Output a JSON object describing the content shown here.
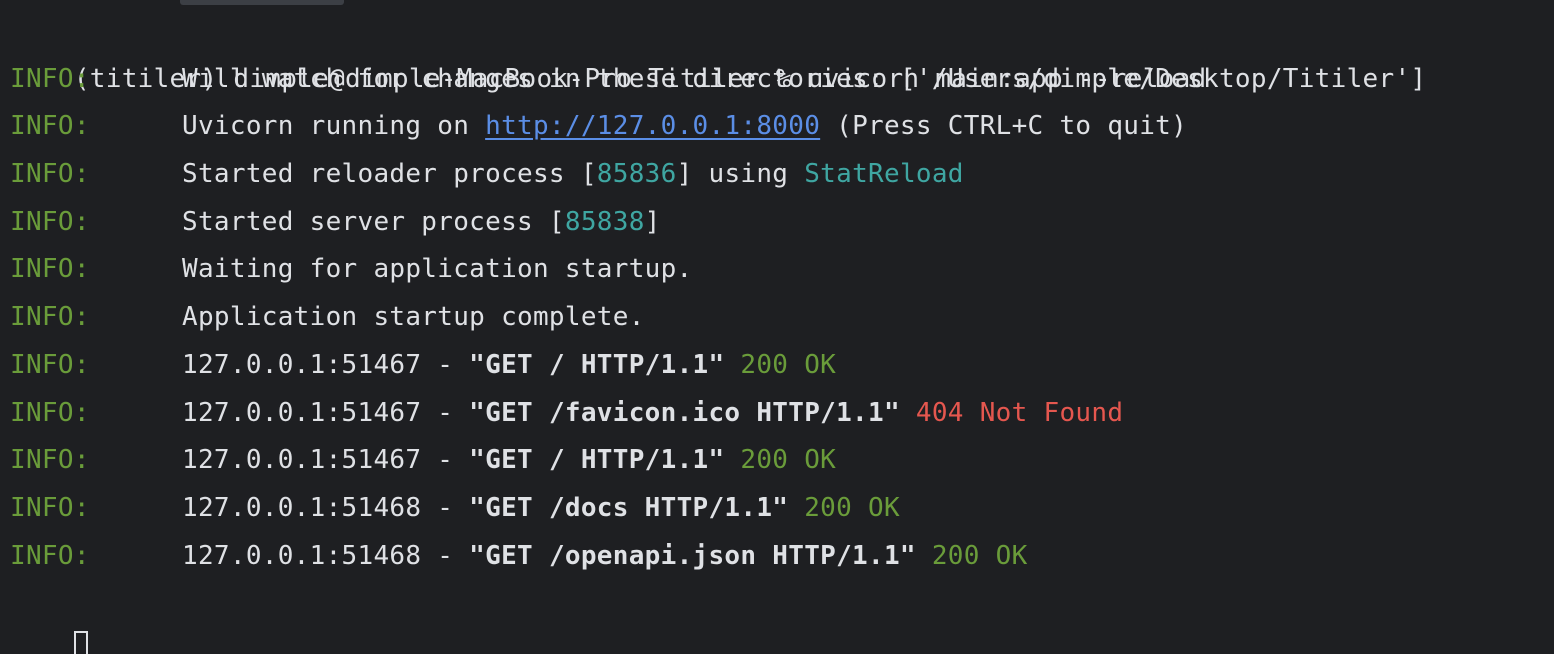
{
  "prompt": {
    "text": "(titiler) dimple@dimple-MacBook-Pro Titiler % uvicorn main:app --reload"
  },
  "lines": [
    {
      "level": "INFO:",
      "text": "Will watch for changes in these directories: ['/Users/dimple/Desktop/Titiler']"
    },
    {
      "level": "INFO:",
      "pre": "Uvicorn running on ",
      "link": "http://127.0.0.1:8000",
      "post": " (Press CTRL+C to quit)"
    },
    {
      "level": "INFO:",
      "pre": "Started reloader process [",
      "pid": "85836",
      "mid": "] using ",
      "highlight": "StatReload"
    },
    {
      "level": "INFO:",
      "pre": "Started server process [",
      "pid": "85838",
      "post": "]"
    },
    {
      "level": "INFO:",
      "text": "Waiting for application startup."
    },
    {
      "level": "INFO:",
      "text": "Application startup complete."
    },
    {
      "level": "INFO:",
      "client": "127.0.0.1:51467 - ",
      "request": "\"GET / HTTP/1.1\"",
      "status": " 200 OK",
      "status_kind": "ok"
    },
    {
      "level": "INFO:",
      "client": "127.0.0.1:51467 - ",
      "request": "\"GET /favicon.ico HTTP/1.1\"",
      "status": " 404 Not Found",
      "status_kind": "err"
    },
    {
      "level": "INFO:",
      "client": "127.0.0.1:51467 - ",
      "request": "\"GET / HTTP/1.1\"",
      "status": " 200 OK",
      "status_kind": "ok"
    },
    {
      "level": "INFO:",
      "client": "127.0.0.1:51468 - ",
      "request": "\"GET /docs HTTP/1.1\"",
      "status": " 200 OK",
      "status_kind": "ok"
    },
    {
      "level": "INFO:",
      "client": "127.0.0.1:51468 - ",
      "request": "\"GET /openapi.json HTTP/1.1\"",
      "status": " 200 OK",
      "status_kind": "ok"
    }
  ],
  "colors": {
    "background": "#1e1f22",
    "foreground": "#dfe1e5",
    "info_green": "#6a9c3a",
    "link_blue": "#5b8ee6",
    "cyan": "#3fa6a2",
    "error_red": "#e5574f"
  }
}
